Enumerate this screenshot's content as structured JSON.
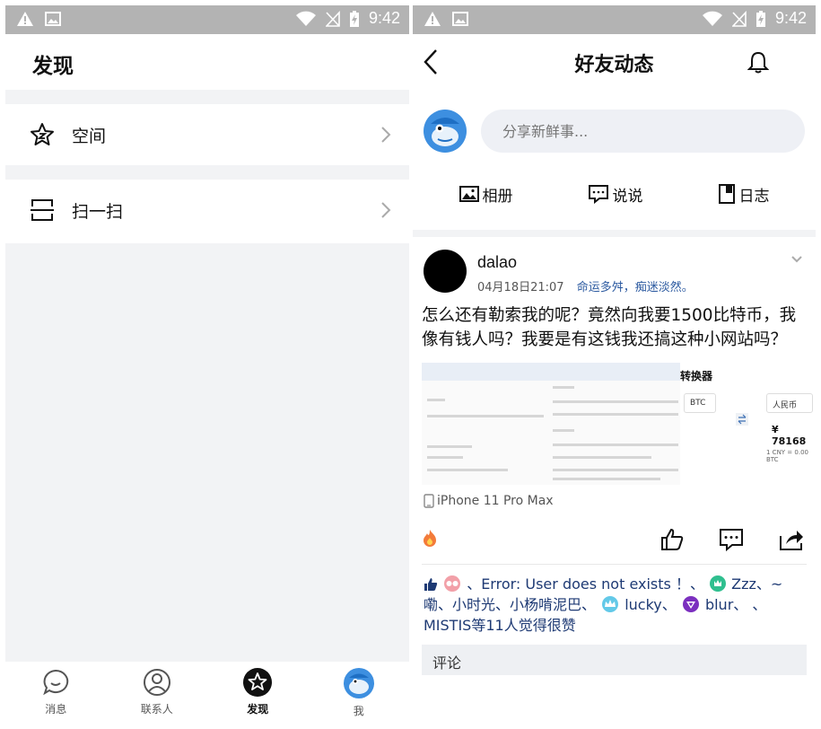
{
  "status": {
    "time": "9:42"
  },
  "left": {
    "title": "发现",
    "items": [
      {
        "label": "空间",
        "icon": "star-icon"
      },
      {
        "label": "扫一扫",
        "icon": "scan-icon"
      }
    ],
    "nav": [
      {
        "label": "消息",
        "icon": "chat-bubble-icon"
      },
      {
        "label": "联系人",
        "icon": "contacts-icon"
      },
      {
        "label": "发现",
        "icon": "discover-star-icon",
        "active": true
      },
      {
        "label": "我",
        "icon": "avatar"
      }
    ]
  },
  "right": {
    "title": "好友动态",
    "share_placeholder": "分享新鲜事...",
    "quick_actions": [
      {
        "label": "相册",
        "icon": "photo-icon"
      },
      {
        "label": "说说",
        "icon": "comment-icon"
      },
      {
        "label": "日志",
        "icon": "diary-icon"
      }
    ],
    "post": {
      "username": "dalao",
      "time": "04月18日21:07",
      "signature": "命运多舛，痴迷淡然。",
      "content": "怎么还有勒索我的呢？竟然向我要1500比特币，我像有钱人吗？我要是有这钱我还搞这种小网站吗？",
      "device": "iPhone 11 Pro Max",
      "image": {
        "converter_title": "转换器",
        "from_currency": "BTC",
        "to_currency": "人民币",
        "amount": "¥ 78168",
        "rate_note": "1 CNY = 0.00 BTC"
      }
    },
    "likes": {
      "part1": "、Error: User does not exists ！、",
      "part2": "Zzz、~嘞、小时光、小杨啃泥巴、",
      "part3": "lucky、",
      "part4": "blur、",
      "part5": "、MISTIS等11人觉得很赞"
    },
    "comment_label": "评论"
  },
  "colors": {
    "link": "#1e3a74",
    "signature": "#2c5aa0",
    "statusbar": "#b3b3b3",
    "gap": "#f2f3f5"
  }
}
